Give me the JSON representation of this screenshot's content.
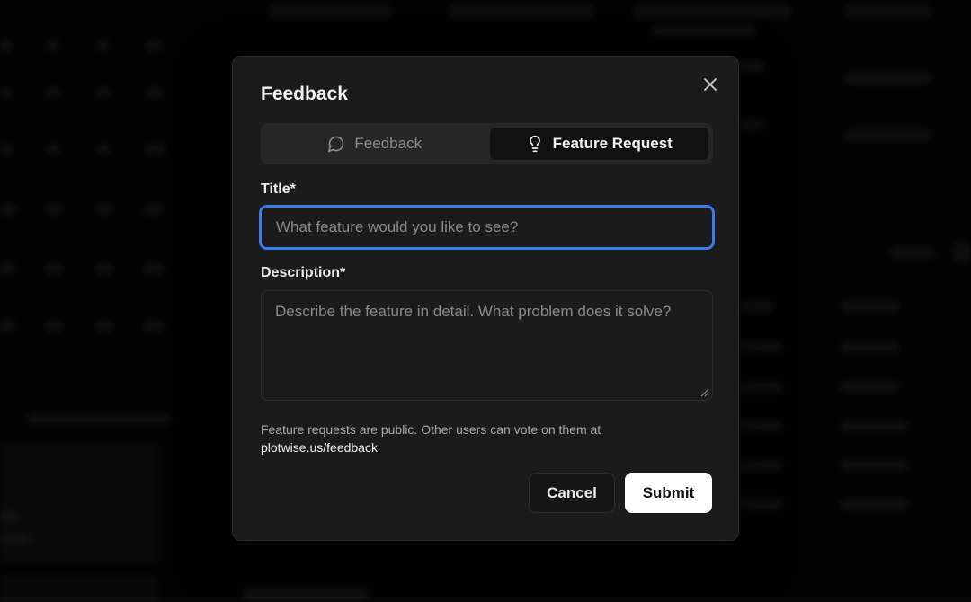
{
  "modal": {
    "title": "Feedback",
    "tabs": [
      {
        "label": "Feedback",
        "icon": "message-circle-icon",
        "active": false
      },
      {
        "label": "Feature Request",
        "icon": "lightbulb-icon",
        "active": true
      }
    ],
    "title_field": {
      "label": "Title*",
      "placeholder": "What feature would you like to see?",
      "value": ""
    },
    "description_field": {
      "label": "Description*",
      "placeholder": "Describe the feature in detail. What problem does it solve?",
      "value": ""
    },
    "notice": {
      "text": "Feature requests are public. Other users can vote on them at",
      "link": "plotwise.us/feedback"
    },
    "buttons": {
      "cancel": "Cancel",
      "submit": "Submit"
    }
  },
  "colors": {
    "focus_ring": "#3a7bf0",
    "modal_bg": "#1b1b1b",
    "page_bg": "#070707"
  }
}
